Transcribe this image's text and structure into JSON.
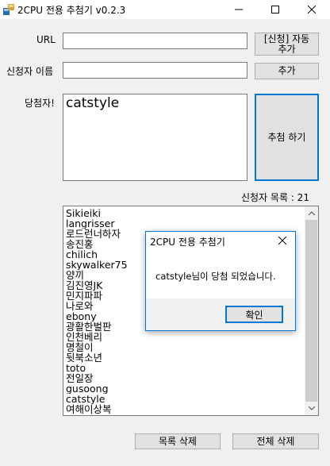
{
  "window": {
    "title": "2CPU 전용 추첨기 v0.2.3",
    "accent": "#0078d7"
  },
  "form": {
    "url_label": "URL",
    "url_value": "",
    "applicant_label": "신청자 이름",
    "applicant_value": "",
    "auto_add_label_line1": "[신청] 자동",
    "auto_add_label_line2": "추가",
    "add_label": "추가",
    "winner_label": "당첨자!",
    "winner_value": "catstyle",
    "draw_label": "추첨 하기",
    "count_label": "신청자 목록 : 21"
  },
  "list": {
    "items": [
      "Sikieiki",
      "langrisser",
      "로드런너하자",
      "송진홍",
      "chilich",
      "skywalker75",
      "양끼",
      "김진영JK",
      "민지파파",
      "나로와",
      "ebony",
      "광활한벌판",
      "인천베리",
      "명철이",
      "뒷북소년",
      "toto",
      "전일장",
      "gusoong",
      "catstyle",
      "여해이상복"
    ]
  },
  "footer": {
    "delete_list_label": "목록 삭제",
    "delete_all_label": "전체 삭제"
  },
  "dialog": {
    "title": "2CPU 전용 추첨기",
    "message": "catstyle님이 당첨 되었습니다.",
    "ok_label": "확인"
  },
  "icons": [
    "app-icon",
    "minimize-icon",
    "maximize-icon",
    "close-icon",
    "scroll-up-icon",
    "scroll-down-icon",
    "dialog-close-icon"
  ]
}
